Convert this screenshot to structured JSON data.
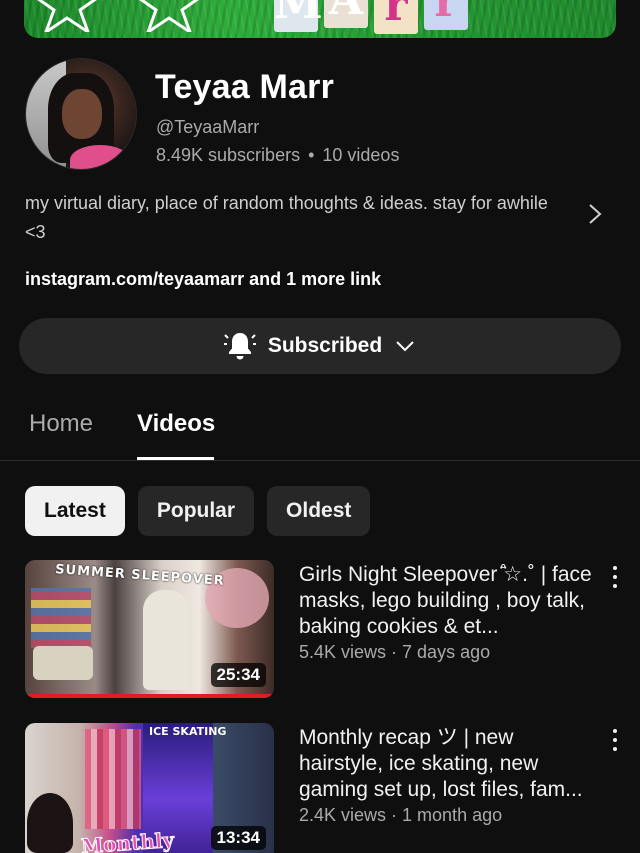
{
  "banner": {
    "letters": [
      "M",
      "A",
      "r",
      "r"
    ]
  },
  "channel": {
    "name": "Teyaa Marr",
    "handle": "@TeyaaMarr",
    "subscribers": "8.49K subscribers",
    "separator": "•",
    "video_count": "10 videos",
    "description": "my virtual diary, place of random thoughts & ideas. stay for awhile <3",
    "links_primary": "instagram.com/teyaamarr",
    "links_more": " and 1 more link"
  },
  "subscribe": {
    "label": "Subscribed"
  },
  "tabs": [
    {
      "label": "Home",
      "selected": false
    },
    {
      "label": "Videos",
      "selected": true
    }
  ],
  "chips": [
    {
      "label": "Latest",
      "selected": true
    },
    {
      "label": "Popular",
      "selected": false
    },
    {
      "label": "Oldest",
      "selected": false
    }
  ],
  "videos": [
    {
      "title": "Girls Night Sleepover ̊̈☆.˚ | face masks, lego building , boy talk, baking cookies & et...",
      "meta": "5.4K views · 7 days ago",
      "duration": "25:34",
      "thumb_text": "SUMMER SLEEPOVER",
      "watched_fraction": 1.0
    },
    {
      "title": "Monthly recap ツ | new hairstyle, ice skating, new gaming set up, lost files, fam...",
      "meta": "2.4K views · 1 month ago",
      "duration": "13:34",
      "thumb_text": "ICE SKATING",
      "thumb_word": "Monthly"
    }
  ],
  "icons": {
    "bell": "bell-icon",
    "chevron_down": "chevron-down-icon",
    "chevron_right": "chevron-right-icon",
    "more": "more-vert-icon"
  },
  "colors": {
    "background": "#0f0f0f",
    "surface": "#272727",
    "chip_active": "#f1f1f1",
    "secondary_text": "#aaaaaa",
    "progress": "#e31b23"
  }
}
